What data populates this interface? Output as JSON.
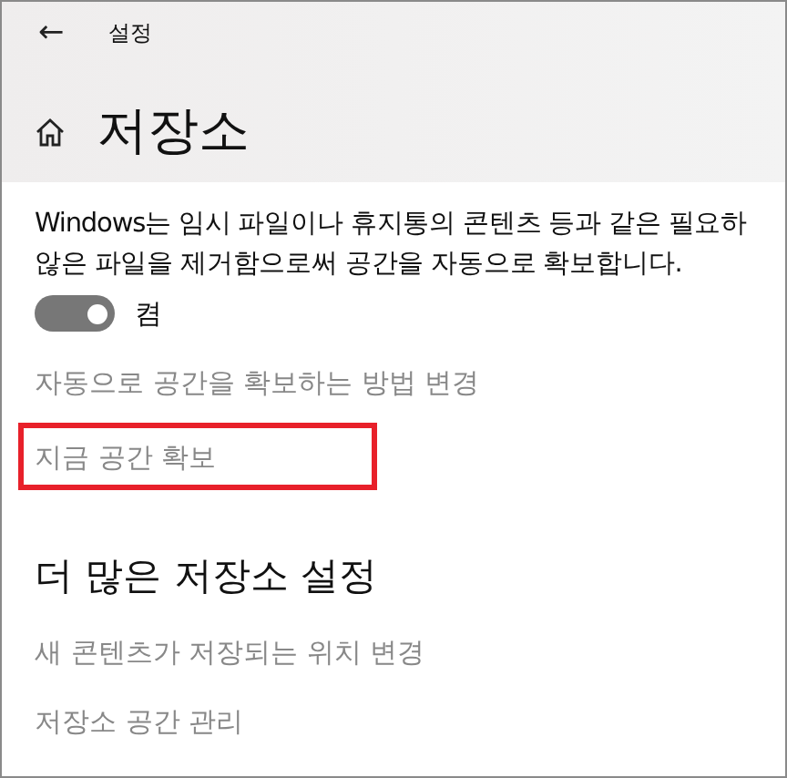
{
  "title_bar": {
    "back": "←",
    "title": "설정"
  },
  "page": {
    "heading": "저장소"
  },
  "storage_sense": {
    "description_lines": [
      "Windows는 임시 파일이나 휴지통의 콘텐츠 등과 같은 필요하",
      "않은 파일을 제거함으로써 공간을 자동으로 확보합니다."
    ],
    "toggle": {
      "on": true,
      "disabled": true,
      "label": "켬"
    },
    "links": [
      {
        "label": "자동으로 공간을 확보하는 방법 변경",
        "highlighted": false
      },
      {
        "label": "지금 공간 확보",
        "highlighted": true
      }
    ]
  },
  "more_settings": {
    "heading": "더 많은 저장소 설정",
    "links": [
      {
        "label": "새 콘텐츠가 저장되는 위치 변경"
      },
      {
        "label": "저장소 공간 관리"
      }
    ]
  }
}
